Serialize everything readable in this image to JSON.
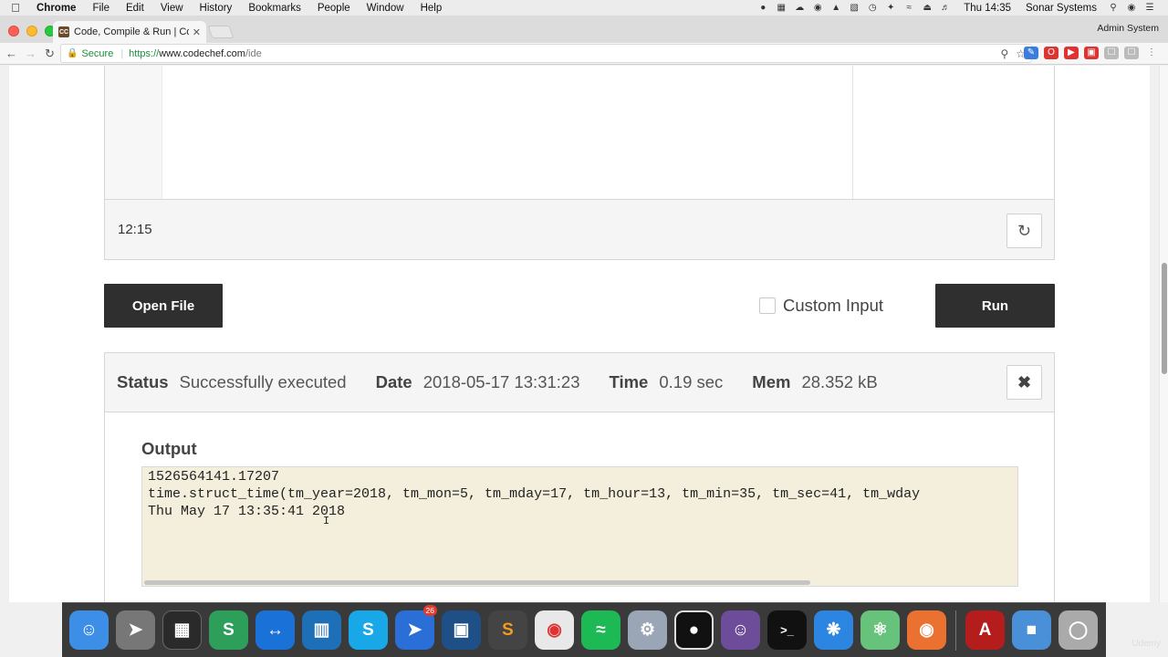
{
  "menubar": {
    "app": "Chrome",
    "items": [
      "File",
      "Edit",
      "View",
      "History",
      "Bookmarks",
      "People",
      "Window",
      "Help"
    ],
    "clock": "Thu 14:35",
    "user": "Sonar Systems"
  },
  "browser": {
    "tab_title": "Code, Compile & Run | CodeCh",
    "tab_favicon": "CC",
    "profile": "Admin System",
    "secure_label": "Secure",
    "url_scheme": "https://",
    "url_host": "www.codechef.com",
    "url_path": "/ide"
  },
  "ide": {
    "cursor_position": "12:15",
    "open_file_label": "Open File",
    "custom_input_label": "Custom Input",
    "run_label": "Run"
  },
  "result": {
    "status_label": "Status",
    "status_value": "Successfully executed",
    "date_label": "Date",
    "date_value": "2018-05-17 13:31:23",
    "time_label": "Time",
    "time_value": "0.19 sec",
    "mem_label": "Mem",
    "mem_value": "28.352 kB",
    "output_label": "Output",
    "output_lines": [
      "1526564141.17207",
      "time.struct_time(tm_year=2018, tm_mon=5, tm_mday=17, tm_hour=13, tm_min=35, tm_sec=41, tm_wday",
      "Thu May 17 13:35:41 2018"
    ]
  },
  "dock": {
    "mail_badge": "26",
    "watermark": "Udemy"
  }
}
